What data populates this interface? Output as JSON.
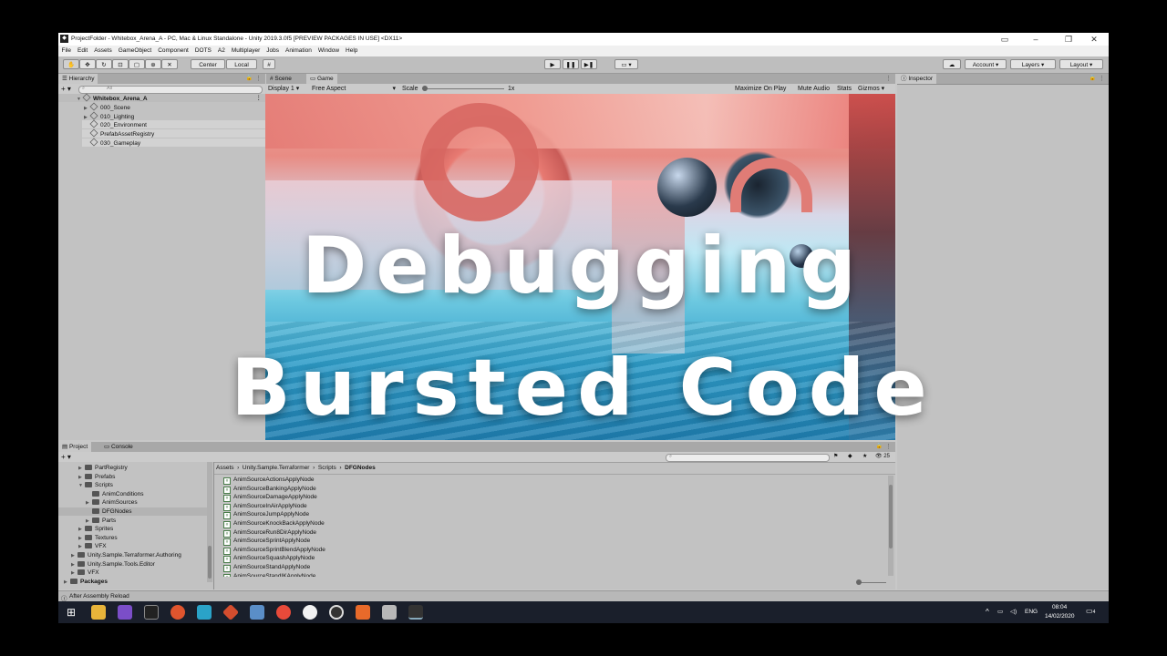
{
  "window": {
    "title": "ProjectFolder - Whitebox_Arena_A - PC, Mac & Linux Standalone - Unity 2019.3.0f5 [PREVIEW PACKAGES IN USE] <DX11>",
    "app_icon": "unity-logo-icon"
  },
  "menu": [
    "File",
    "Edit",
    "Assets",
    "GameObject",
    "Component",
    "DOTS",
    "A2",
    "Multiplayer",
    "Jobs",
    "Animation",
    "Window",
    "Help"
  ],
  "toolbar": {
    "center_label": "Center",
    "local_label": "Local",
    "account_label": "Account",
    "layers_label": "Layers",
    "layout_label": "Layout"
  },
  "hierarchy": {
    "tab": "Hierarchy",
    "search_placeholder": "All",
    "scene": "Whitebox_Arena_A",
    "items": [
      "000_Scene",
      "010_Lighting",
      "020_Environment",
      "PrefabAssetRegistry",
      "030_Gameplay"
    ]
  },
  "scene_tabs": {
    "scene": "Scene",
    "game": "Game"
  },
  "game_bar": {
    "display": "Display 1",
    "aspect": "Free Aspect",
    "scale_label": "Scale",
    "scale_value": "1x",
    "maximize": "Maximize On Play",
    "mute": "Mute Audio",
    "stats": "Stats",
    "gizmos": "Gizmos"
  },
  "inspector": {
    "tab": "Inspector"
  },
  "overlay": {
    "line1": "Debugging",
    "line2": "Bursted Code"
  },
  "project": {
    "tab": "Project",
    "console_tab": "Console",
    "tree": [
      {
        "label": "PartRegistry",
        "indent": 1,
        "expand": "right"
      },
      {
        "label": "Prefabs",
        "indent": 1,
        "expand": "right"
      },
      {
        "label": "Scripts",
        "indent": 1,
        "expand": "down"
      },
      {
        "label": "AnimConditions",
        "indent": 2,
        "expand": ""
      },
      {
        "label": "AnimSources",
        "indent": 2,
        "expand": "right"
      },
      {
        "label": "DFGNodes",
        "indent": 2,
        "expand": "",
        "selected": true
      },
      {
        "label": "Parts",
        "indent": 2,
        "expand": "right"
      },
      {
        "label": "Sprites",
        "indent": 1,
        "expand": "right"
      },
      {
        "label": "Textures",
        "indent": 1,
        "expand": "right"
      },
      {
        "label": "VFX",
        "indent": 1,
        "expand": "right"
      },
      {
        "label": "Unity.Sample.Terraformer.Authoring",
        "indent": 0,
        "expand": "right"
      },
      {
        "label": "Unity.Sample.Tools.Editor",
        "indent": 0,
        "expand": "right"
      },
      {
        "label": "VFX",
        "indent": 0,
        "expand": "right"
      },
      {
        "label": "Packages",
        "indent": -1,
        "expand": "right",
        "bold": true
      }
    ],
    "breadcrumb": [
      "Assets",
      "Unity.Sample.Terraformer",
      "Scripts",
      "DFGNodes"
    ],
    "hidden_count": "25",
    "files": [
      "AnimSourceActionsApplyNode",
      "AnimSourceBankingApplyNode",
      "AnimSourceDamageApplyNode",
      "AnimSourceInAirApplyNode",
      "AnimSourceJumpApplyNode",
      "AnimSourceKnockBackApplyNode",
      "AnimSourceRun8DirApplyNode",
      "AnimSourceSprintApplyNode",
      "AnimSourceSprintBlendApplyNode",
      "AnimSourceSquashApplyNode",
      "AnimSourceStandApplyNode",
      "AnimSourceStandIKApplyNode"
    ]
  },
  "status": {
    "text": "After Assembly Reload"
  },
  "taskbar": {
    "language": "ENG",
    "time": "08:04",
    "date": "14/02/2020",
    "notifications": "4"
  }
}
